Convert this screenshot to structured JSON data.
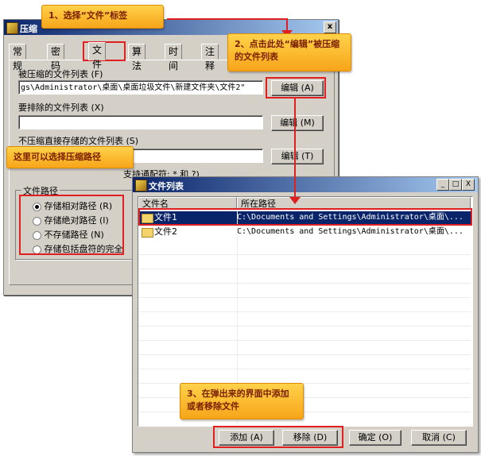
{
  "main_window": {
    "title": "压缩",
    "close_label": "x",
    "tabs": [
      "常规",
      "密码",
      "文件",
      "算法",
      "时间",
      "注释"
    ],
    "compressed_list_label": "被压缩的文件列表 (F)",
    "compressed_list_value": "gs\\Administrator\\桌面\\桌面垃圾文件\\新建文件夹\\文件2\"",
    "exclude_label": "要排除的文件列表 (X)",
    "exclude_value": "",
    "store_label": "不压缩直接存储的文件列表 (S)",
    "store_value": "",
    "wildcard_note": "支持通配符: * 和 ?)",
    "edit_a": "编辑 (A)",
    "edit_m": "编辑 (M)",
    "edit_t": "编辑 (T)",
    "path_group_title": "文件路径",
    "path_options": [
      "存储相对路径 (R)",
      "存储绝对路径 (I)",
      "不存储路径 (N)",
      "存储包括盘符的完全"
    ],
    "selected_option_index": 0
  },
  "file_list_window": {
    "title": "文件列表",
    "controls": [
      "_",
      "□",
      "X"
    ],
    "columns": [
      "文件名",
      "所在路径"
    ],
    "rows": [
      {
        "name": "文件1",
        "path": "C:\\Documents and Settings\\Administrator\\桌面\\...",
        "selected": true
      },
      {
        "name": "文件2",
        "path": "C:\\Documents and Settings\\Administrator\\桌面\\...",
        "selected": false
      }
    ],
    "buttons": {
      "add": "添加 (A)",
      "remove": "移除 (D)",
      "ok": "确定 (O)",
      "cancel": "取消 (C)"
    }
  },
  "callouts": {
    "step1": "1、选择“文件”标签",
    "step2": "2、点击此处“编辑”被压缩的文件列表",
    "path_tip": "这里可以选择压缩路径",
    "step3": "3、在弹出来的界面中添加或者移除文件"
  },
  "colors": {
    "callout_bg": "#f9b52a",
    "highlight_red": "#e02020",
    "titlebar": "#0a246a",
    "window_face": "#d4d0c8"
  }
}
